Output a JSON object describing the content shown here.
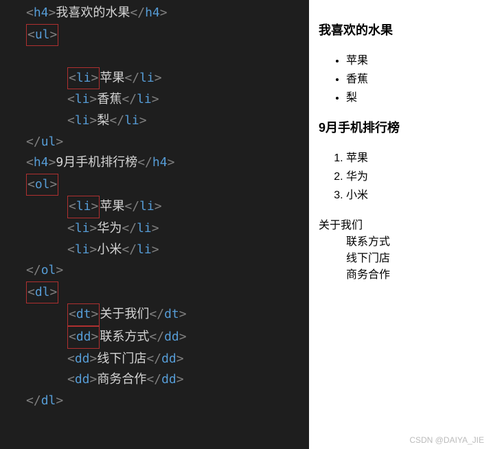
{
  "code": {
    "h4_1_text": "我喜欢的水果",
    "ul_items": [
      "苹果",
      "香蕉",
      "梨"
    ],
    "h4_2_text": "9月手机排行榜",
    "ol_items": [
      "苹果",
      "华为",
      "小米"
    ],
    "dl_dt": "关于我们",
    "dl_dd": [
      "联系方式",
      "线下门店",
      "商务合作"
    ],
    "tags": {
      "h4": "h4",
      "ul": "ul",
      "ol": "ol",
      "li": "li",
      "dl": "dl",
      "dt": "dt",
      "dd": "dd"
    }
  },
  "preview": {
    "heading1": "我喜欢的水果",
    "ul": [
      "苹果",
      "香蕉",
      "梨"
    ],
    "heading2": "9月手机排行榜",
    "ol": [
      "苹果",
      "华为",
      "小米"
    ],
    "dt": "关于我们",
    "dd": [
      "联系方式",
      "线下门店",
      "商务合作"
    ]
  },
  "watermark": "CSDN @DAIYA_JIE"
}
